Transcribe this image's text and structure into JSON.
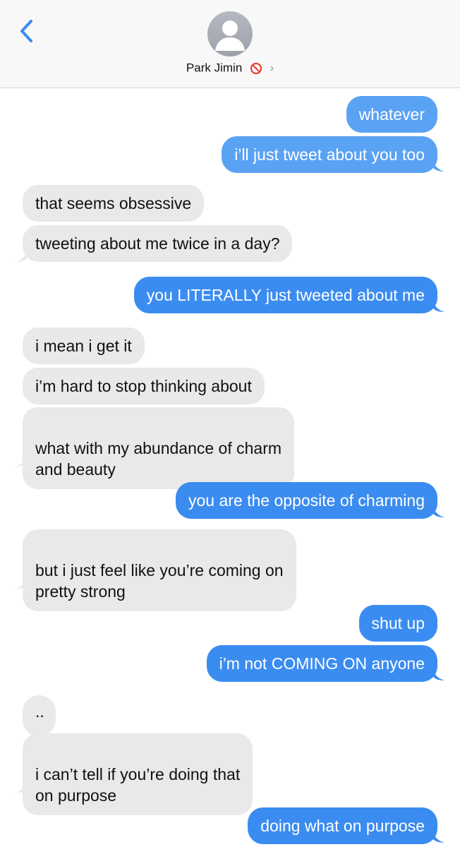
{
  "header": {
    "contact_name": "Park Jimin",
    "chevron": "›",
    "back_icon": "chevron-left-icon",
    "block_icon": "blocked-circle-icon",
    "accent": "#3b8cf0"
  },
  "messages": [
    {
      "dir": "out",
      "text": "whatever"
    },
    {
      "dir": "out",
      "text": "i’ll just tweet about you too"
    },
    {
      "dir": "in",
      "text": "that seems obsessive"
    },
    {
      "dir": "in",
      "text": "tweeting about me twice in a day?"
    },
    {
      "dir": "out",
      "text": "you LITERALLY just tweeted about me"
    },
    {
      "dir": "in",
      "text": "i mean i get it"
    },
    {
      "dir": "in",
      "text": "i’m hard to stop thinking about"
    },
    {
      "dir": "in",
      "text": "what with my abundance of charm\nand beauty"
    },
    {
      "dir": "out",
      "text": "you are the opposite of charming"
    },
    {
      "dir": "in",
      "text": "but i just feel like you’re coming on\npretty strong"
    },
    {
      "dir": "out",
      "text": "shut up"
    },
    {
      "dir": "out",
      "text": "i’m not COMING ON anyone"
    },
    {
      "dir": "in",
      "text": ".."
    },
    {
      "dir": "in",
      "text": "i can’t tell if you’re doing that\non purpose"
    },
    {
      "dir": "out",
      "text": "doing what on purpose"
    }
  ]
}
